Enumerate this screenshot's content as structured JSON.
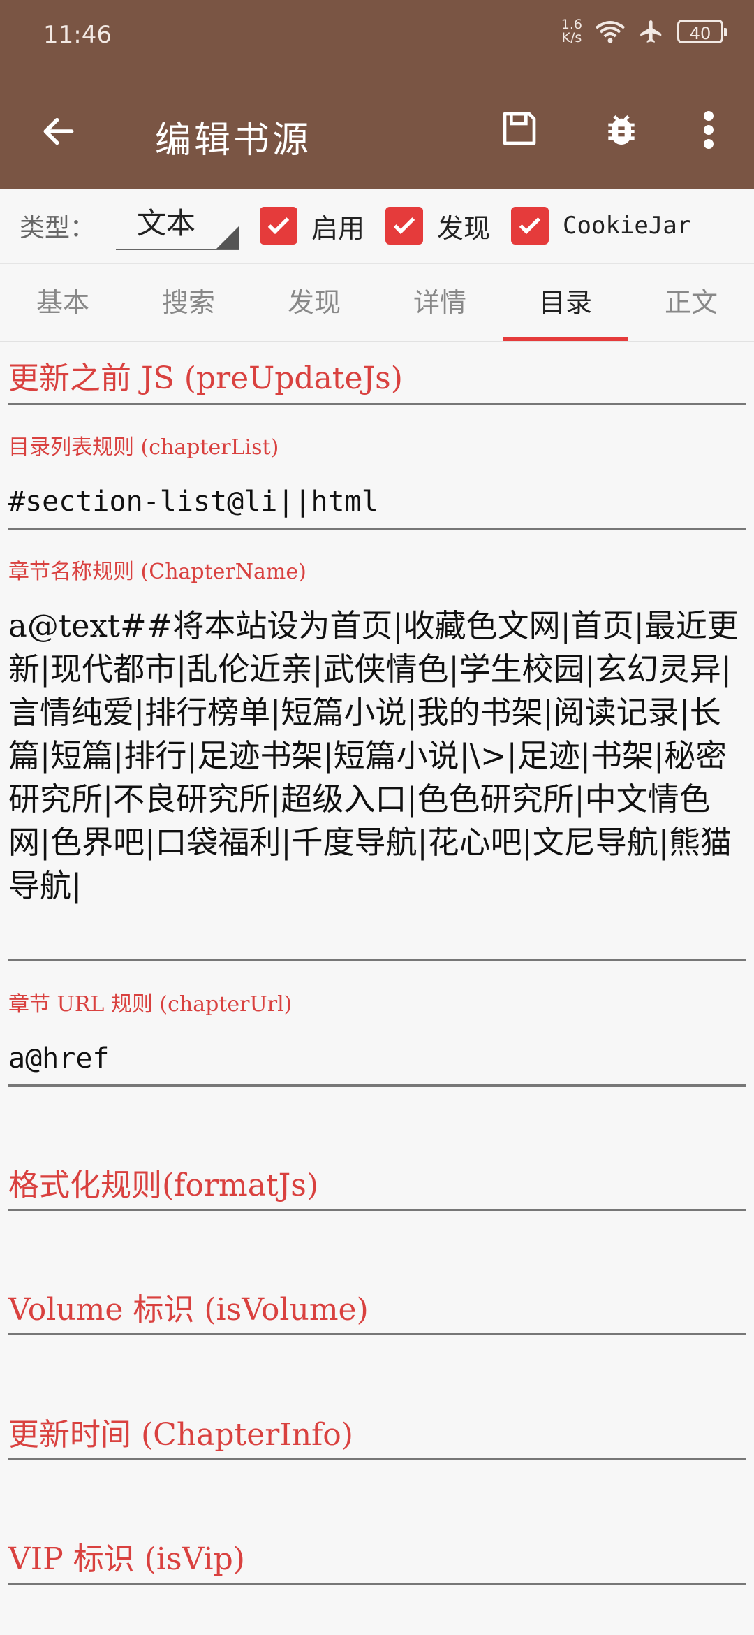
{
  "status": {
    "time": "11:46",
    "net_speed_value": "1.6",
    "net_speed_unit": "K/s",
    "battery": "40"
  },
  "appbar": {
    "title": "编辑书源"
  },
  "meta": {
    "type_label": "类型：",
    "type_value": "文本",
    "checkboxes": [
      {
        "label": "启用",
        "checked": true
      },
      {
        "label": "发现",
        "checked": true
      },
      {
        "label": "CookieJar",
        "checked": true
      }
    ]
  },
  "tabs": [
    {
      "label": "基本",
      "active": false
    },
    {
      "label": "搜索",
      "active": false
    },
    {
      "label": "发现",
      "active": false
    },
    {
      "label": "详情",
      "active": false
    },
    {
      "label": "目录",
      "active": true
    },
    {
      "label": "正文",
      "active": false
    }
  ],
  "fields": {
    "preupdate": {
      "hint": "更新之前 JS (preUpdateJs)",
      "value": ""
    },
    "chapterlist": {
      "hint": "目录列表规则 (chapterList)",
      "value": "#section-list@li||html"
    },
    "chaptername": {
      "hint": "章节名称规则 (ChapterName)",
      "value": "a@text##将本站设为首页|收藏色文网|首页|最近更新|现代都市|乱伦近亲|武侠情色|学生校园|玄幻灵异|言情纯爱|排行榜单|短篇小说|我的书架|阅读记录|长篇|短篇|排行|足迹书架|短篇小说|\\>|足迹|书架|秘密研究所|不良研究所|超级入口|色色研究所|中文情色网|色界吧|口袋福利|千度导航|花心吧|文尼导航|熊猫导航|"
    },
    "chapterurl": {
      "hint": "章节 URL 规则 (chapterUrl)",
      "value": "a@href"
    },
    "formatjs": {
      "hint": "格式化规则(formatJs)",
      "value": ""
    },
    "isvolume": {
      "hint": "Volume 标识 (isVolume)",
      "value": ""
    },
    "chapterinfo": {
      "hint": "更新时间 (ChapterInfo)",
      "value": ""
    },
    "isvip": {
      "hint": "VIP 标识 (isVip)",
      "value": ""
    }
  },
  "colors": {
    "appbar": "#7a5544",
    "accent": "#e53b3b",
    "hint": "#d9413f"
  },
  "icons": {
    "back": "arrow-left",
    "save": "floppy-disk",
    "debug": "bug",
    "more": "dots-vertical"
  }
}
